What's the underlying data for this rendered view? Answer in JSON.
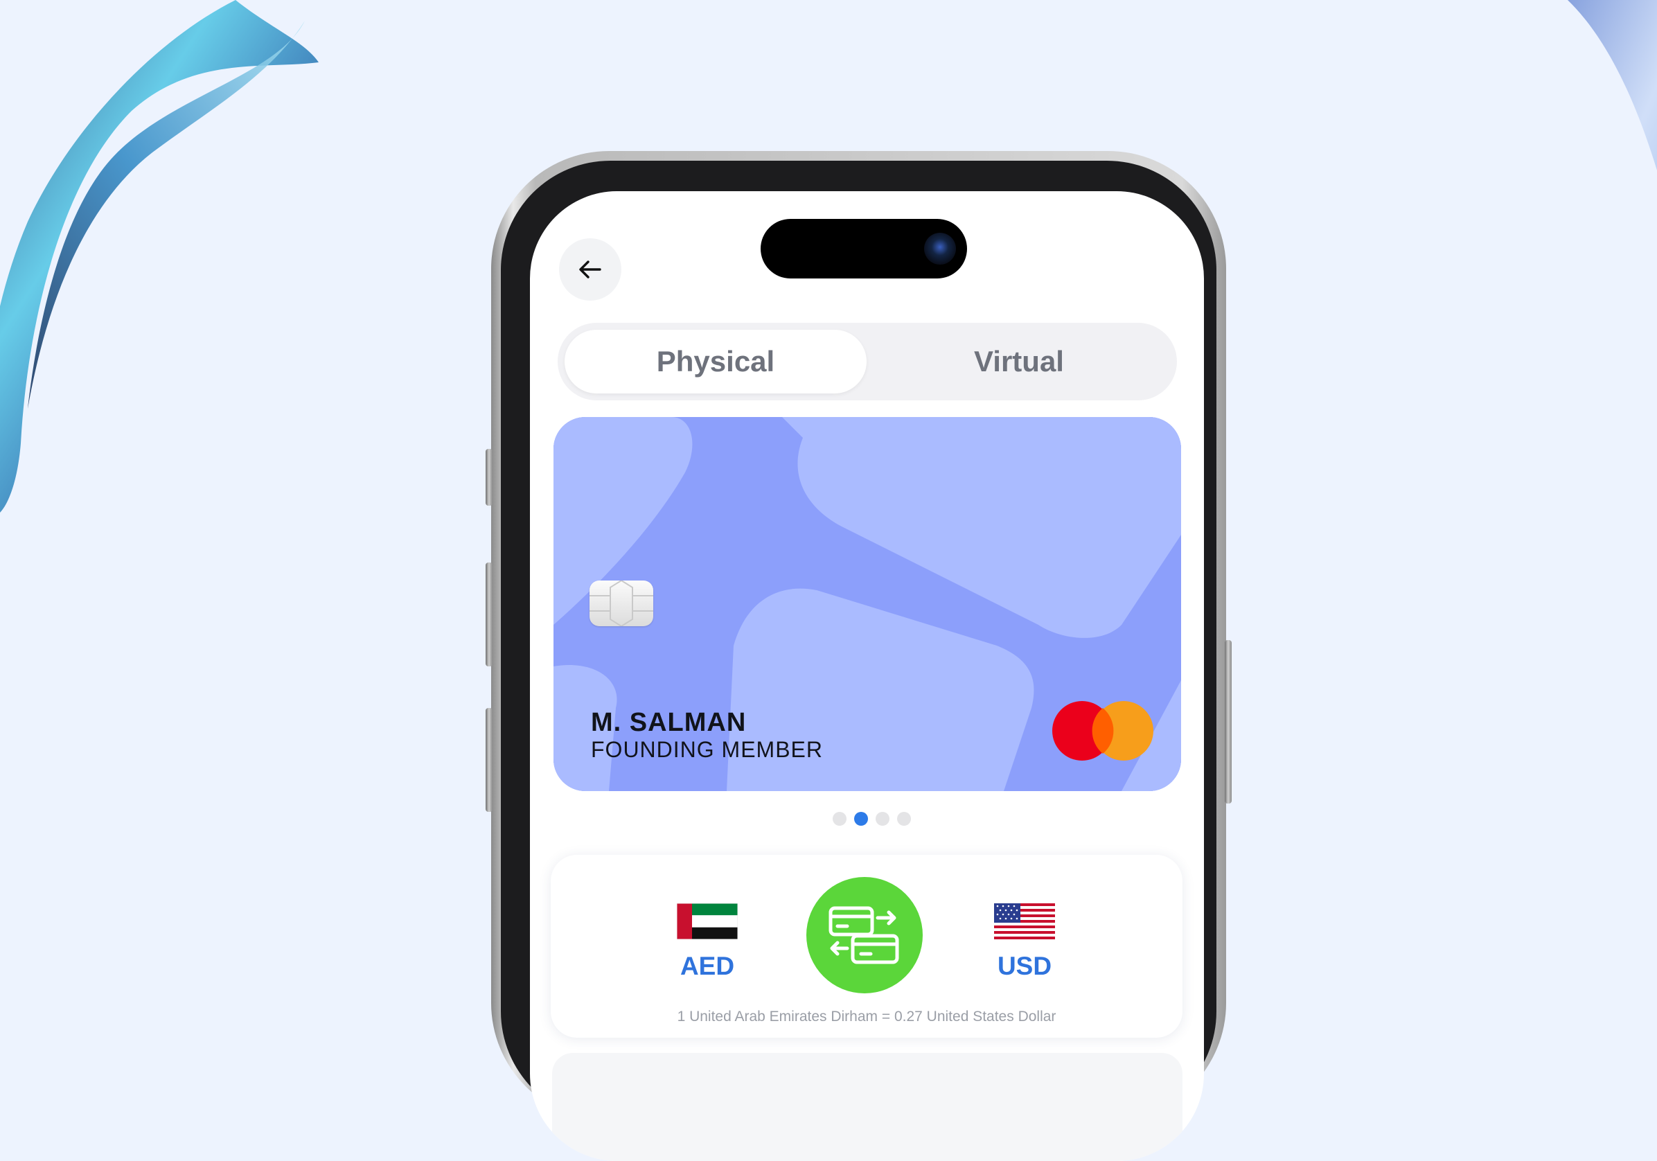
{
  "segmented_control": {
    "tabs": [
      {
        "label": "Physical",
        "active": true
      },
      {
        "label": "Virtual",
        "active": false
      }
    ]
  },
  "card": {
    "holder_name": "M. SALMAN",
    "membership": "FOUNDING MEMBER",
    "network_logo": "mastercard",
    "carousel_total": 4,
    "carousel_active_index": 1
  },
  "converter": {
    "from_currency": "AED",
    "to_currency": "USD",
    "from_flag": "uae-flag",
    "to_flag": "us-flag",
    "rate_text": "1 United Arab Emirates Dirham = 0.27 United States Dollar",
    "swap_icon": "card-exchange-icon"
  },
  "colors": {
    "accent": "#2f73dc",
    "swap_button": "#5bd63a",
    "card_base": "#8c9ffb",
    "card_light": "#aabbff"
  },
  "icons": {
    "back": "arrow-left-icon"
  }
}
